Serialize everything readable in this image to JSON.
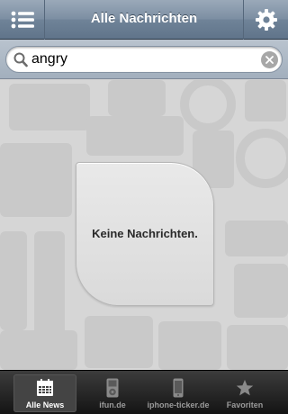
{
  "navbar": {
    "title": "Alle Nachrichten",
    "menu_icon": "list-icon",
    "settings_icon": "gear-icon"
  },
  "search": {
    "value": "angry",
    "search_icon": "magnifier-icon",
    "clear_icon": "clear-icon"
  },
  "content": {
    "empty_message": "Keine Nachrichten."
  },
  "tabbar": {
    "tabs": [
      {
        "label": "Alle News",
        "icon": "calendar-icon",
        "selected": true
      },
      {
        "label": "ifun.de",
        "icon": "ipod-icon",
        "selected": false
      },
      {
        "label": "iphone-ticker.de",
        "icon": "iphone-icon",
        "selected": false
      },
      {
        "label": "Favoriten",
        "icon": "star-icon",
        "selected": false
      }
    ]
  }
}
